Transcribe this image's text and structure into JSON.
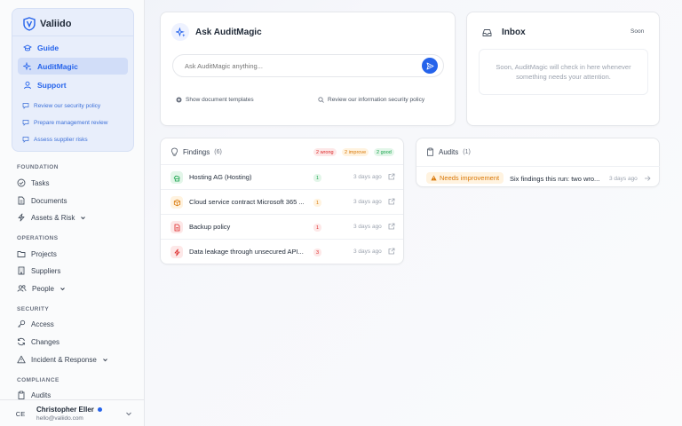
{
  "brand": {
    "name": "Valiido"
  },
  "assistant_nav": [
    {
      "label": "Guide",
      "icon": "graduation-cap-icon",
      "active": false
    },
    {
      "label": "AuditMagic",
      "icon": "sparkles-icon",
      "active": true
    },
    {
      "label": "Support",
      "icon": "user-icon",
      "active": false
    }
  ],
  "quick_prompts": [
    "Review our security policy",
    "Prepare management review",
    "Assess supplier risks"
  ],
  "nav_sections": {
    "foundation": {
      "heading": "FOUNDATION",
      "items": [
        {
          "label": "Tasks",
          "icon": "check-circle-icon"
        },
        {
          "label": "Documents",
          "icon": "document-icon"
        },
        {
          "label": "Assets & Risk",
          "icon": "bolt-icon",
          "expandable": true
        }
      ]
    },
    "operations": {
      "heading": "OPERATIONS",
      "items": [
        {
          "label": "Projects",
          "icon": "folder-icon"
        },
        {
          "label": "Suppliers",
          "icon": "building-icon"
        },
        {
          "label": "People",
          "icon": "users-icon",
          "expandable": true
        }
      ]
    },
    "security": {
      "heading": "SECURITY",
      "items": [
        {
          "label": "Access",
          "icon": "key-icon"
        },
        {
          "label": "Changes",
          "icon": "refresh-icon"
        },
        {
          "label": "Incident & Response",
          "icon": "warning-icon",
          "expandable": true
        }
      ]
    },
    "compliance": {
      "heading": "COMPLIANCE",
      "items": [
        {
          "label": "Audits",
          "icon": "clipboard-icon"
        }
      ]
    }
  },
  "user": {
    "initials": "CE",
    "name": "Christopher Eller",
    "email": "hello@valiido.com"
  },
  "ask": {
    "title": "Ask AuditMagic",
    "placeholder": "Ask AuditMagic anything...",
    "links": [
      "Show document templates",
      "Review our information security policy"
    ]
  },
  "inbox": {
    "title": "Inbox",
    "badge": "Soon",
    "message": "Soon, AuditMagic will check in here whenever something needs your attention."
  },
  "findings": {
    "title": "Findings",
    "count": "(6)",
    "pills": {
      "wrong": "2 wrong",
      "improve": "2 improve",
      "good": "2 good"
    },
    "rows": [
      {
        "title": "Hosting AG (Hosting)",
        "count": "1",
        "status": "good",
        "time": "3 days ago",
        "icon": "cloud-server-icon"
      },
      {
        "title": "Cloud service contract Microsoft 365 ...",
        "count": "1",
        "status": "improve",
        "time": "3 days ago",
        "icon": "box-icon"
      },
      {
        "title": "Backup policy",
        "count": "1",
        "status": "wrong",
        "time": "3 days ago",
        "icon": "file-icon"
      },
      {
        "title": "Data leakage through unsecured API...",
        "count": "3",
        "status": "wrong",
        "time": "3 days ago",
        "icon": "lightning-icon"
      }
    ]
  },
  "audits": {
    "title": "Audits",
    "count": "(1)",
    "row": {
      "badge": "Needs improvement",
      "text": "Six findings this run: two wro...",
      "time": "3 days ago"
    }
  },
  "colors": {
    "accent": "#2563eb",
    "wrong": "#dc2626",
    "improve": "#d97706",
    "good": "#16a34a"
  }
}
